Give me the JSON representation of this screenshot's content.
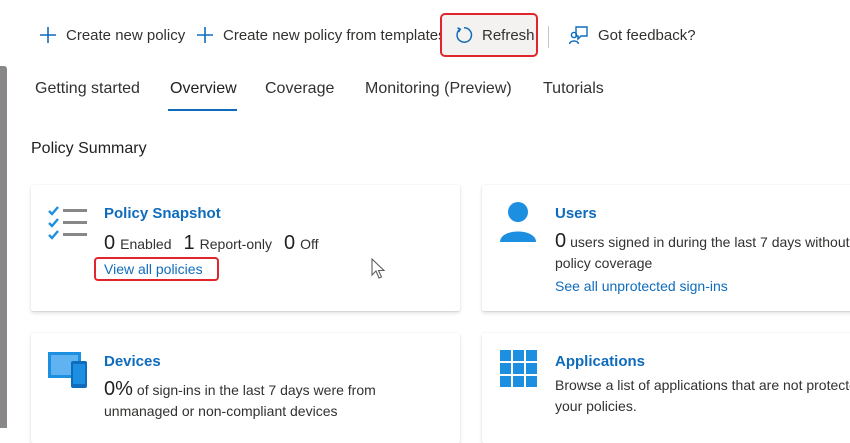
{
  "toolbar": {
    "create_label": "Create new policy",
    "create_template_label": "Create new policy from templates",
    "refresh_label": "Refresh",
    "feedback_label": "Got feedback?"
  },
  "tabs": [
    {
      "label": "Getting started",
      "active": false
    },
    {
      "label": "Overview",
      "active": true
    },
    {
      "label": "Coverage",
      "active": false
    },
    {
      "label": "Monitoring (Preview)",
      "active": false
    },
    {
      "label": "Tutorials",
      "active": false
    }
  ],
  "section_title": "Policy Summary",
  "cards": {
    "snapshot": {
      "title": "Policy Snapshot",
      "enabled_count": "0",
      "enabled_label": "Enabled",
      "report_only_count": "1",
      "report_only_label": "Report-only",
      "off_count": "0",
      "off_label": "Off",
      "link": "View all policies"
    },
    "users": {
      "title": "Users",
      "count": "0",
      "text_line1": "users signed in during the last 7 days without",
      "text_line2": "policy coverage",
      "link": "See all unprotected sign-ins"
    },
    "devices": {
      "title": "Devices",
      "percent": "0%",
      "text_line1": "of sign-ins in the last 7 days were from",
      "text_line2": "unmanaged or non-compliant devices"
    },
    "applications": {
      "title": "Applications",
      "text_line1": "Browse a list of applications that are not protected by",
      "text_line2": "your policies."
    }
  },
  "colors": {
    "accent": "#0f6cbd",
    "highlight": "#e0262c",
    "icon_blue": "#1d8fe0"
  },
  "icons": {
    "create": "plus-icon",
    "refresh": "refresh-icon",
    "feedback": "feedback-icon",
    "snapshot": "checklist-icon",
    "users": "user-icon",
    "devices": "devices-icon",
    "applications": "app-grid-icon"
  }
}
